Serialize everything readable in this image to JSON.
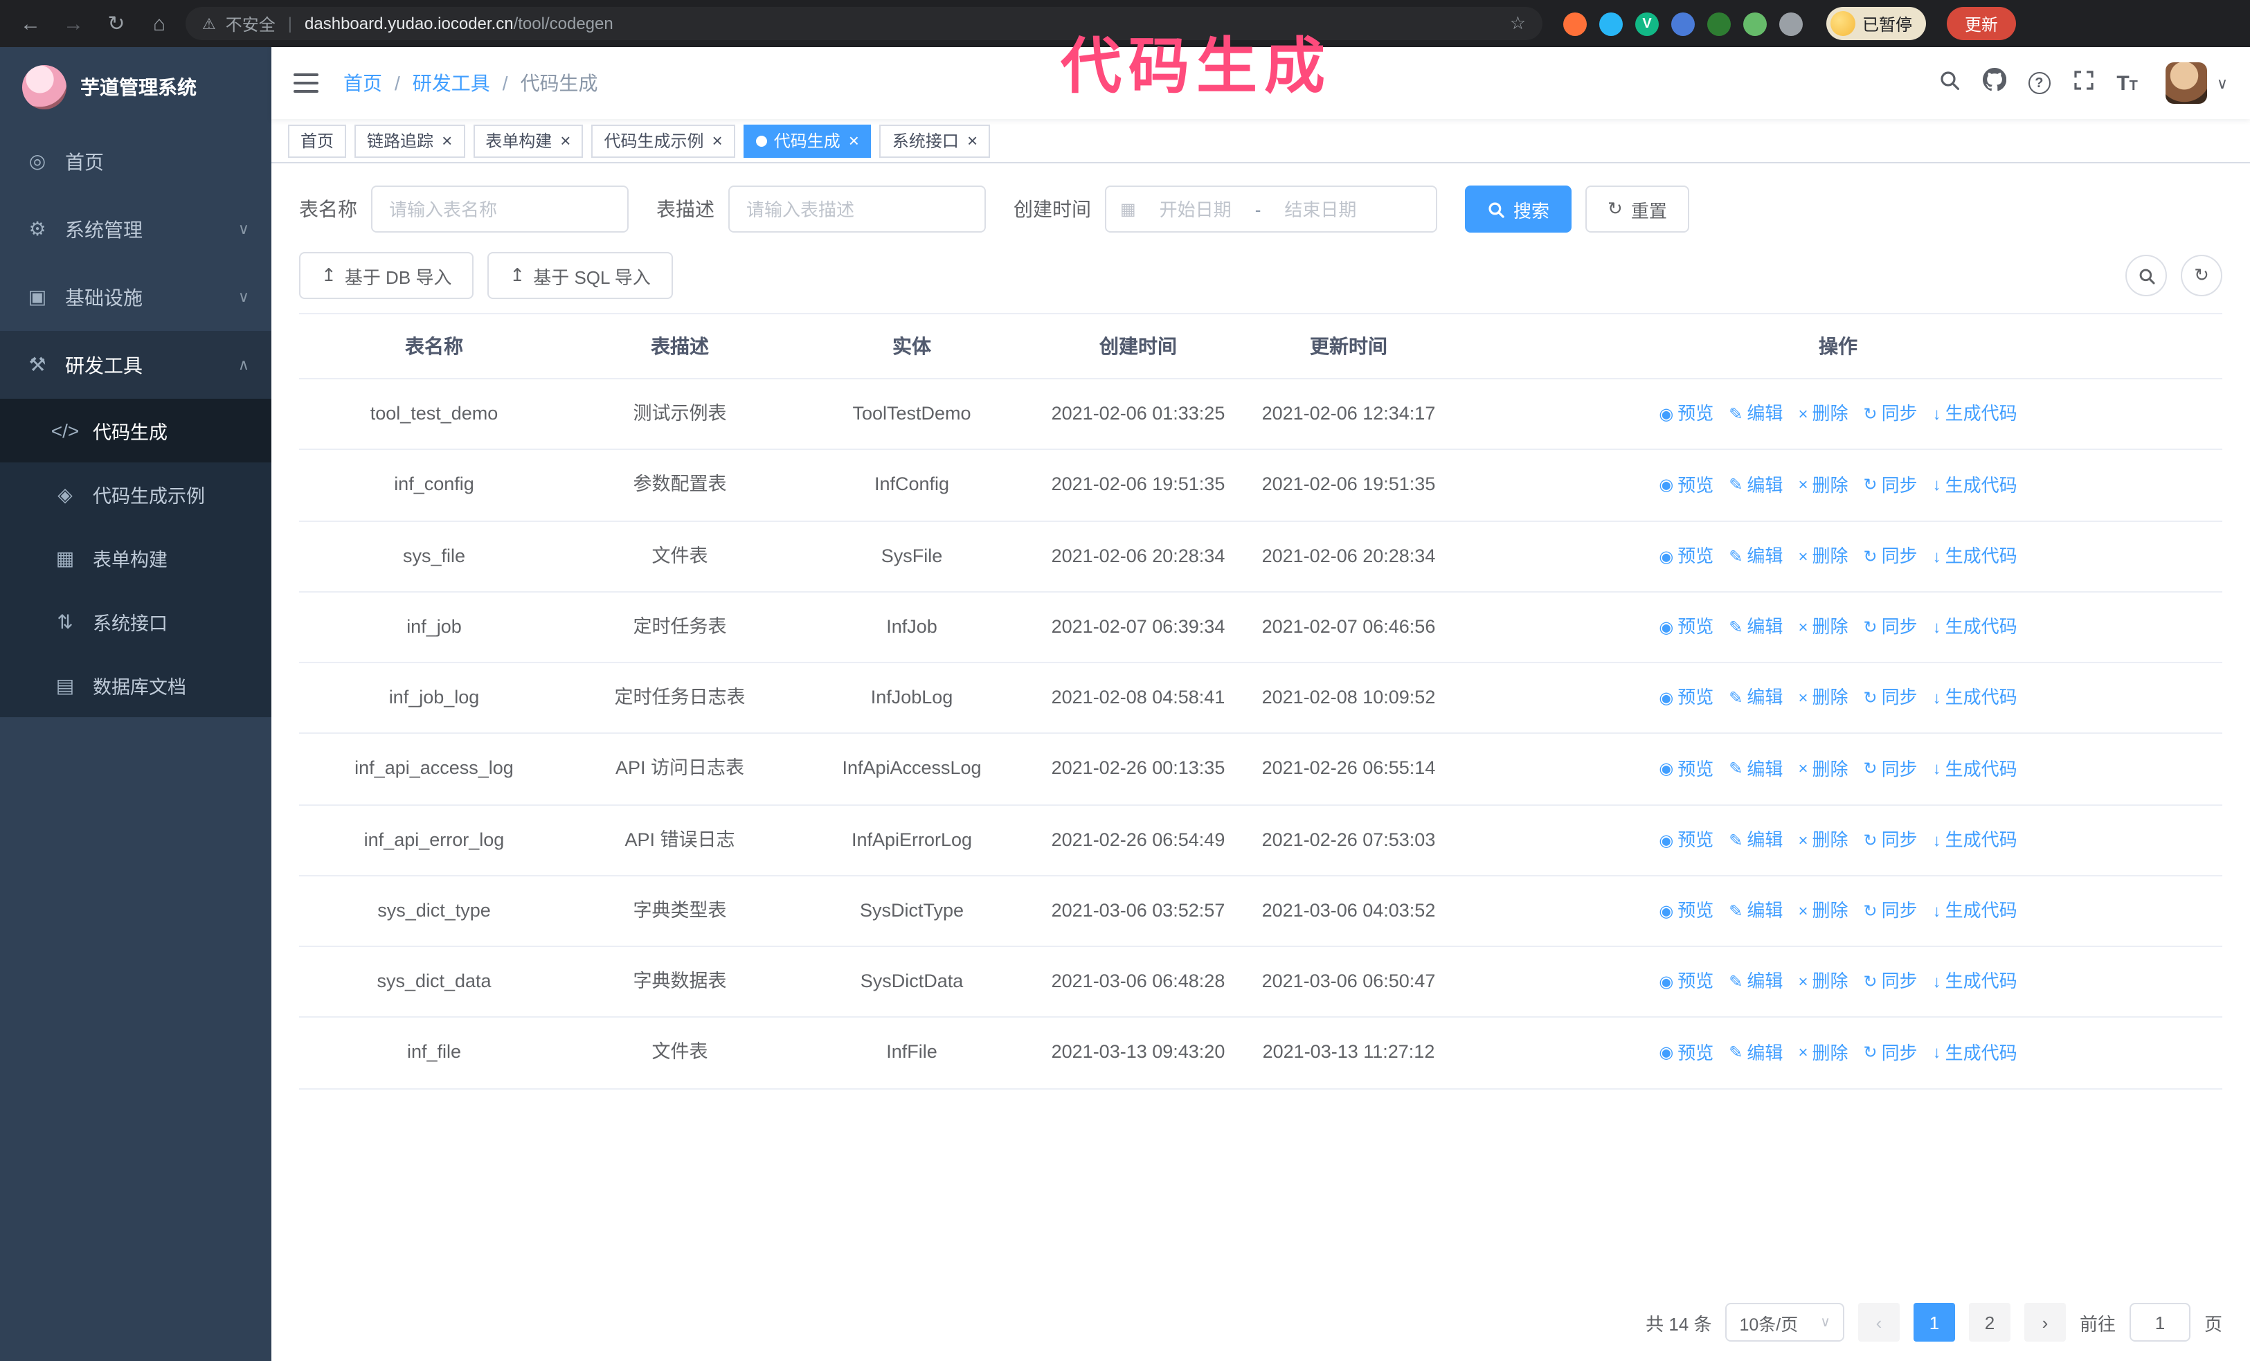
{
  "browser": {
    "security_label": "不安全",
    "url_host": "dashboard.yudao.iocoder.cn",
    "url_path": "/tool/codegen",
    "profile_chip": "已暂停",
    "update_button": "更新",
    "extensions": [
      {
        "name": "extension-fox-icon",
        "color": "#ff7139"
      },
      {
        "name": "extension-drop-icon",
        "color": "#29b6f6"
      },
      {
        "name": "extension-v-icon",
        "color": "#12b886",
        "glyph": "V"
      },
      {
        "name": "extension-people-icon",
        "color": "#4a7bd8"
      },
      {
        "name": "extension-tag-icon",
        "color": "#2e7d32"
      },
      {
        "name": "extension-leaf-icon",
        "color": "#66bb6a"
      },
      {
        "name": "extension-puzzle-icon",
        "color": "#9aa0a6"
      }
    ]
  },
  "overlay_title": "代码生成",
  "icons": {
    "back": "←",
    "forward": "→",
    "reload": "↻",
    "home": "⌂",
    "warning": "⚠",
    "star": "☆",
    "calendar": "▦",
    "upload": "↥",
    "reset": "↻",
    "refresh": "↻",
    "caret_down": "∨",
    "help": "?",
    "font_big": "T",
    "font_small": "T",
    "eye": "◉",
    "edit": "✎",
    "delete": "×",
    "sync": "↻",
    "download": "↓",
    "prev": "‹",
    "next": "›"
  },
  "sidebar": {
    "logo_title": "芋道管理系统",
    "items": [
      {
        "label": "首页",
        "icon": "◎",
        "icon_name": "home-icon"
      },
      {
        "label": "系统管理",
        "icon": "⚙",
        "icon_name": "gear-icon",
        "chevron": "∨"
      },
      {
        "label": "基础设施",
        "icon": "▣",
        "icon_name": "monitor-icon",
        "chevron": "∨"
      },
      {
        "label": "研发工具",
        "icon": "⚒",
        "icon_name": "tools-icon",
        "chevron": "∧",
        "expanded": true
      }
    ],
    "sub_items": [
      {
        "label": "代码生成",
        "icon": "</>",
        "icon_name": "code-icon",
        "key": "code-generation",
        "active": true
      },
      {
        "label": "代码生成示例",
        "icon": "◈",
        "icon_name": "example-icon",
        "key": "codegen-example"
      },
      {
        "label": "表单构建",
        "icon": "▦",
        "icon_name": "form-icon",
        "key": "form-builder"
      },
      {
        "label": "系统接口",
        "icon": "⇅",
        "icon_name": "api-icon",
        "key": "system-api"
      },
      {
        "label": "数据库文档",
        "icon": "▤",
        "icon_name": "database-icon",
        "key": "db-doc"
      }
    ]
  },
  "header": {
    "breadcrumb": [
      "首页",
      "研发工具",
      "代码生成"
    ]
  },
  "tabs": [
    {
      "label": "首页",
      "closable": false,
      "active": false
    },
    {
      "label": "链路追踪",
      "closable": true,
      "active": false
    },
    {
      "label": "表单构建",
      "closable": true,
      "active": false
    },
    {
      "label": "代码生成示例",
      "closable": true,
      "active": false
    },
    {
      "label": "代码生成",
      "closable": true,
      "active": true
    },
    {
      "label": "系统接口",
      "closable": true,
      "active": false
    }
  ],
  "filters": {
    "table_name_label": "表名称",
    "table_name_placeholder": "请输入表名称",
    "table_desc_label": "表描述",
    "table_desc_placeholder": "请输入表描述",
    "create_time_label": "创建时间",
    "date_start_placeholder": "开始日期",
    "date_separator": "-",
    "date_end_placeholder": "结束日期",
    "search_button": "搜索",
    "reset_button": "重置"
  },
  "toolbar": {
    "import_db_button": "基于 DB 导入",
    "import_sql_button": "基于 SQL 导入"
  },
  "table": {
    "columns": [
      "表名称",
      "表描述",
      "实体",
      "创建时间",
      "更新时间",
      "操作"
    ],
    "actions": [
      "预览",
      "编辑",
      "删除",
      "同步",
      "生成代码"
    ],
    "rows": [
      {
        "name": "tool_test_demo",
        "desc": "测试示例表",
        "entity": "ToolTestDemo",
        "created": "2021-02-06 01:33:25",
        "updated": "2021-02-06 12:34:17"
      },
      {
        "name": "inf_config",
        "desc": "参数配置表",
        "entity": "InfConfig",
        "created": "2021-02-06 19:51:35",
        "updated": "2021-02-06 19:51:35"
      },
      {
        "name": "sys_file",
        "desc": "文件表",
        "entity": "SysFile",
        "created": "2021-02-06 20:28:34",
        "updated": "2021-02-06 20:28:34"
      },
      {
        "name": "inf_job",
        "desc": "定时任务表",
        "entity": "InfJob",
        "created": "2021-02-07 06:39:34",
        "updated": "2021-02-07 06:46:56"
      },
      {
        "name": "inf_job_log",
        "desc": "定时任务日志表",
        "entity": "InfJobLog",
        "created": "2021-02-08 04:58:41",
        "updated": "2021-02-08 10:09:52"
      },
      {
        "name": "inf_api_access_log",
        "desc": "API 访问日志表",
        "entity": "InfApiAccessLog",
        "created": "2021-02-26 00:13:35",
        "updated": "2021-02-26 06:55:14"
      },
      {
        "name": "inf_api_error_log",
        "desc": "API 错误日志",
        "entity": "InfApiErrorLog",
        "created": "2021-02-26 06:54:49",
        "updated": "2021-02-26 07:53:03"
      },
      {
        "name": "sys_dict_type",
        "desc": "字典类型表",
        "entity": "SysDictType",
        "created": "2021-03-06 03:52:57",
        "updated": "2021-03-06 04:03:52"
      },
      {
        "name": "sys_dict_data",
        "desc": "字典数据表",
        "entity": "SysDictData",
        "created": "2021-03-06 06:48:28",
        "updated": "2021-03-06 06:50:47"
      },
      {
        "name": "inf_file",
        "desc": "文件表",
        "entity": "InfFile",
        "created": "2021-03-13 09:43:20",
        "updated": "2021-03-13 11:27:12"
      }
    ]
  },
  "pagination": {
    "total": "共 14 条",
    "page_size": "10条/页",
    "pages": [
      "1",
      "2"
    ],
    "current": "1",
    "goto_label": "前往",
    "goto_value": "1",
    "page_unit": "页"
  }
}
